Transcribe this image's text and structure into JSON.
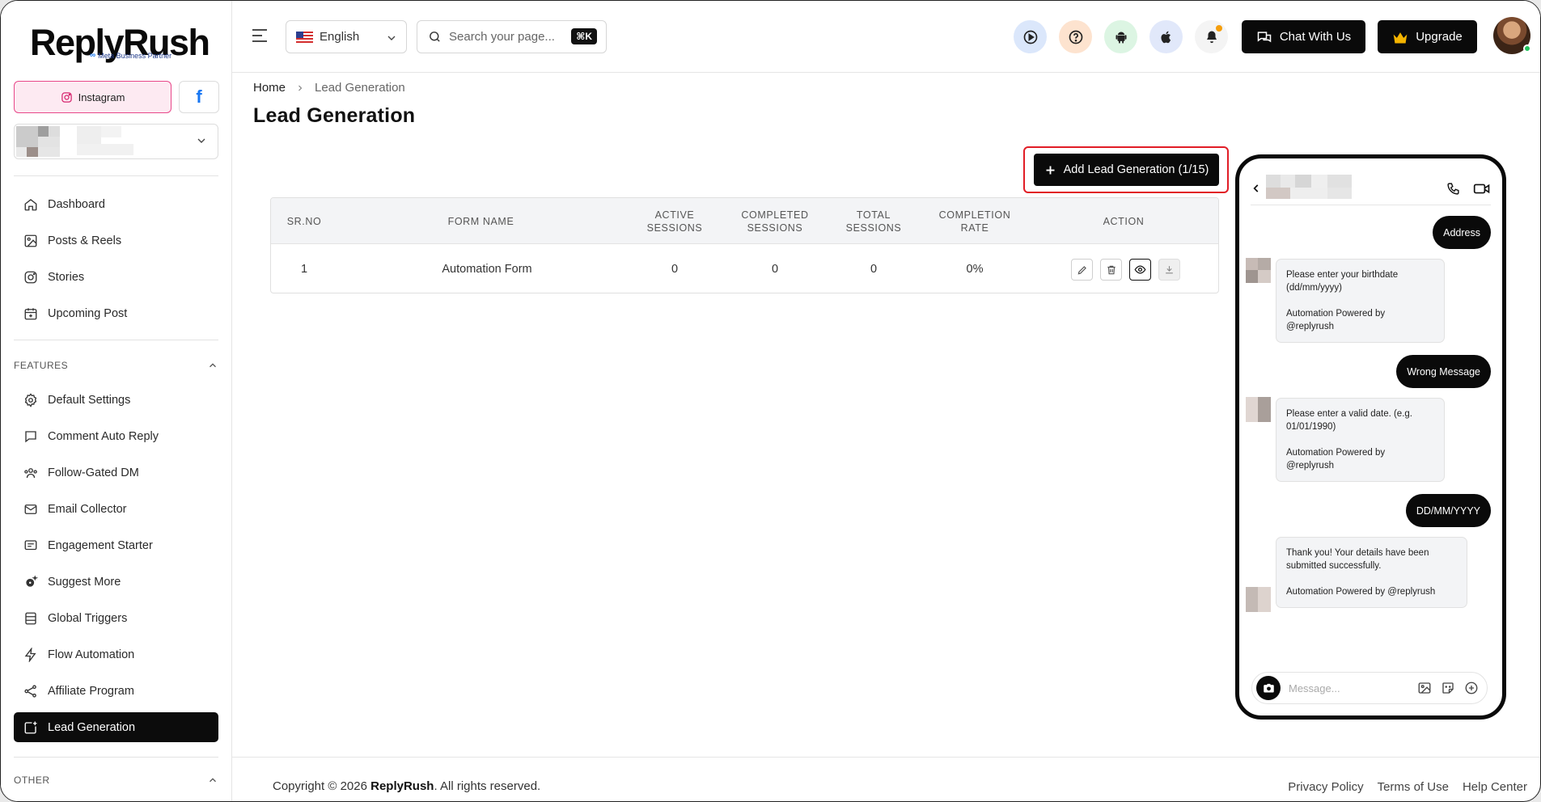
{
  "brand": {
    "name": "ReplyRush",
    "badge": "Meta Business Partner"
  },
  "platforms": {
    "instagram_label": "Instagram",
    "facebook_glyph": "f"
  },
  "sidebar": {
    "main_items": [
      {
        "label": "Dashboard",
        "icon": "home-icon"
      },
      {
        "label": "Posts & Reels",
        "icon": "image-icon"
      },
      {
        "label": "Stories",
        "icon": "instagram-icon"
      },
      {
        "label": "Upcoming Post",
        "icon": "calendar-plus-icon"
      }
    ],
    "features_heading": "FEATURES",
    "feature_items": [
      {
        "label": "Default Settings",
        "icon": "gear-icon"
      },
      {
        "label": "Comment Auto Reply",
        "icon": "comment-icon"
      },
      {
        "label": "Follow-Gated DM",
        "icon": "users-icon"
      },
      {
        "label": "Email Collector",
        "icon": "mail-icon"
      },
      {
        "label": "Engagement Starter",
        "icon": "message-lines-icon"
      },
      {
        "label": "Suggest More",
        "icon": "gear-sparkle-icon"
      },
      {
        "label": "Global Triggers",
        "icon": "list-icon"
      },
      {
        "label": "Flow Automation",
        "icon": "bolt-icon"
      },
      {
        "label": "Affiliate Program",
        "icon": "share-icon"
      },
      {
        "label": "Lead Generation",
        "icon": "lead-add-icon",
        "active": true
      }
    ],
    "other_heading": "OTHER"
  },
  "topbar": {
    "language": "English",
    "search_placeholder": "Search your page...",
    "search_shortcut": "⌘K",
    "chat_button": "Chat With Us",
    "upgrade_button": "Upgrade"
  },
  "breadcrumb": {
    "home": "Home",
    "current": "Lead Generation"
  },
  "page": {
    "title": "Lead Generation",
    "add_button": "Add Lead Generation (1/15)"
  },
  "table": {
    "headers": [
      "SR.NO",
      "FORM NAME",
      "ACTIVE\nSESSIONS",
      "COMPLETED\nSESSIONS",
      "TOTAL\nSESSIONS",
      "COMPLETION\nRATE",
      "ACTION"
    ],
    "rows": [
      {
        "sr": "1",
        "form_name": "Automation Form",
        "active": "0",
        "completed": "0",
        "total": "0",
        "rate": "0%"
      }
    ]
  },
  "preview": {
    "messages": [
      {
        "type": "out",
        "text": "Address"
      },
      {
        "type": "in",
        "lines": [
          "Please enter your birthdate (dd/mm/yyyy)",
          "Automation Powered by @replyrush"
        ]
      },
      {
        "type": "out",
        "text": "Wrong Message"
      },
      {
        "type": "in",
        "lines": [
          "Please enter a valid date. (e.g. 01/01/1990)",
          "Automation Powered by @replyrush"
        ]
      },
      {
        "type": "out",
        "text": "DD/MM/YYYY"
      },
      {
        "type": "in",
        "lines": [
          "Thank you! Your details have been submitted successfully.",
          "Automation Powered by @replyrush"
        ]
      }
    ],
    "message_placeholder": "Message..."
  },
  "footer": {
    "copyright_prefix": "Copyright © 2026 ",
    "copyright_brand": "ReplyRush",
    "copyright_suffix": ". All rights reserved.",
    "links": [
      "Privacy Policy",
      "Terms of Use",
      "Help Center"
    ]
  },
  "colors": {
    "accent_dark": "#0a0a0a",
    "highlight_red": "#e11d26",
    "instagram_pink": "#e8488a",
    "facebook_blue": "#1877f2"
  }
}
